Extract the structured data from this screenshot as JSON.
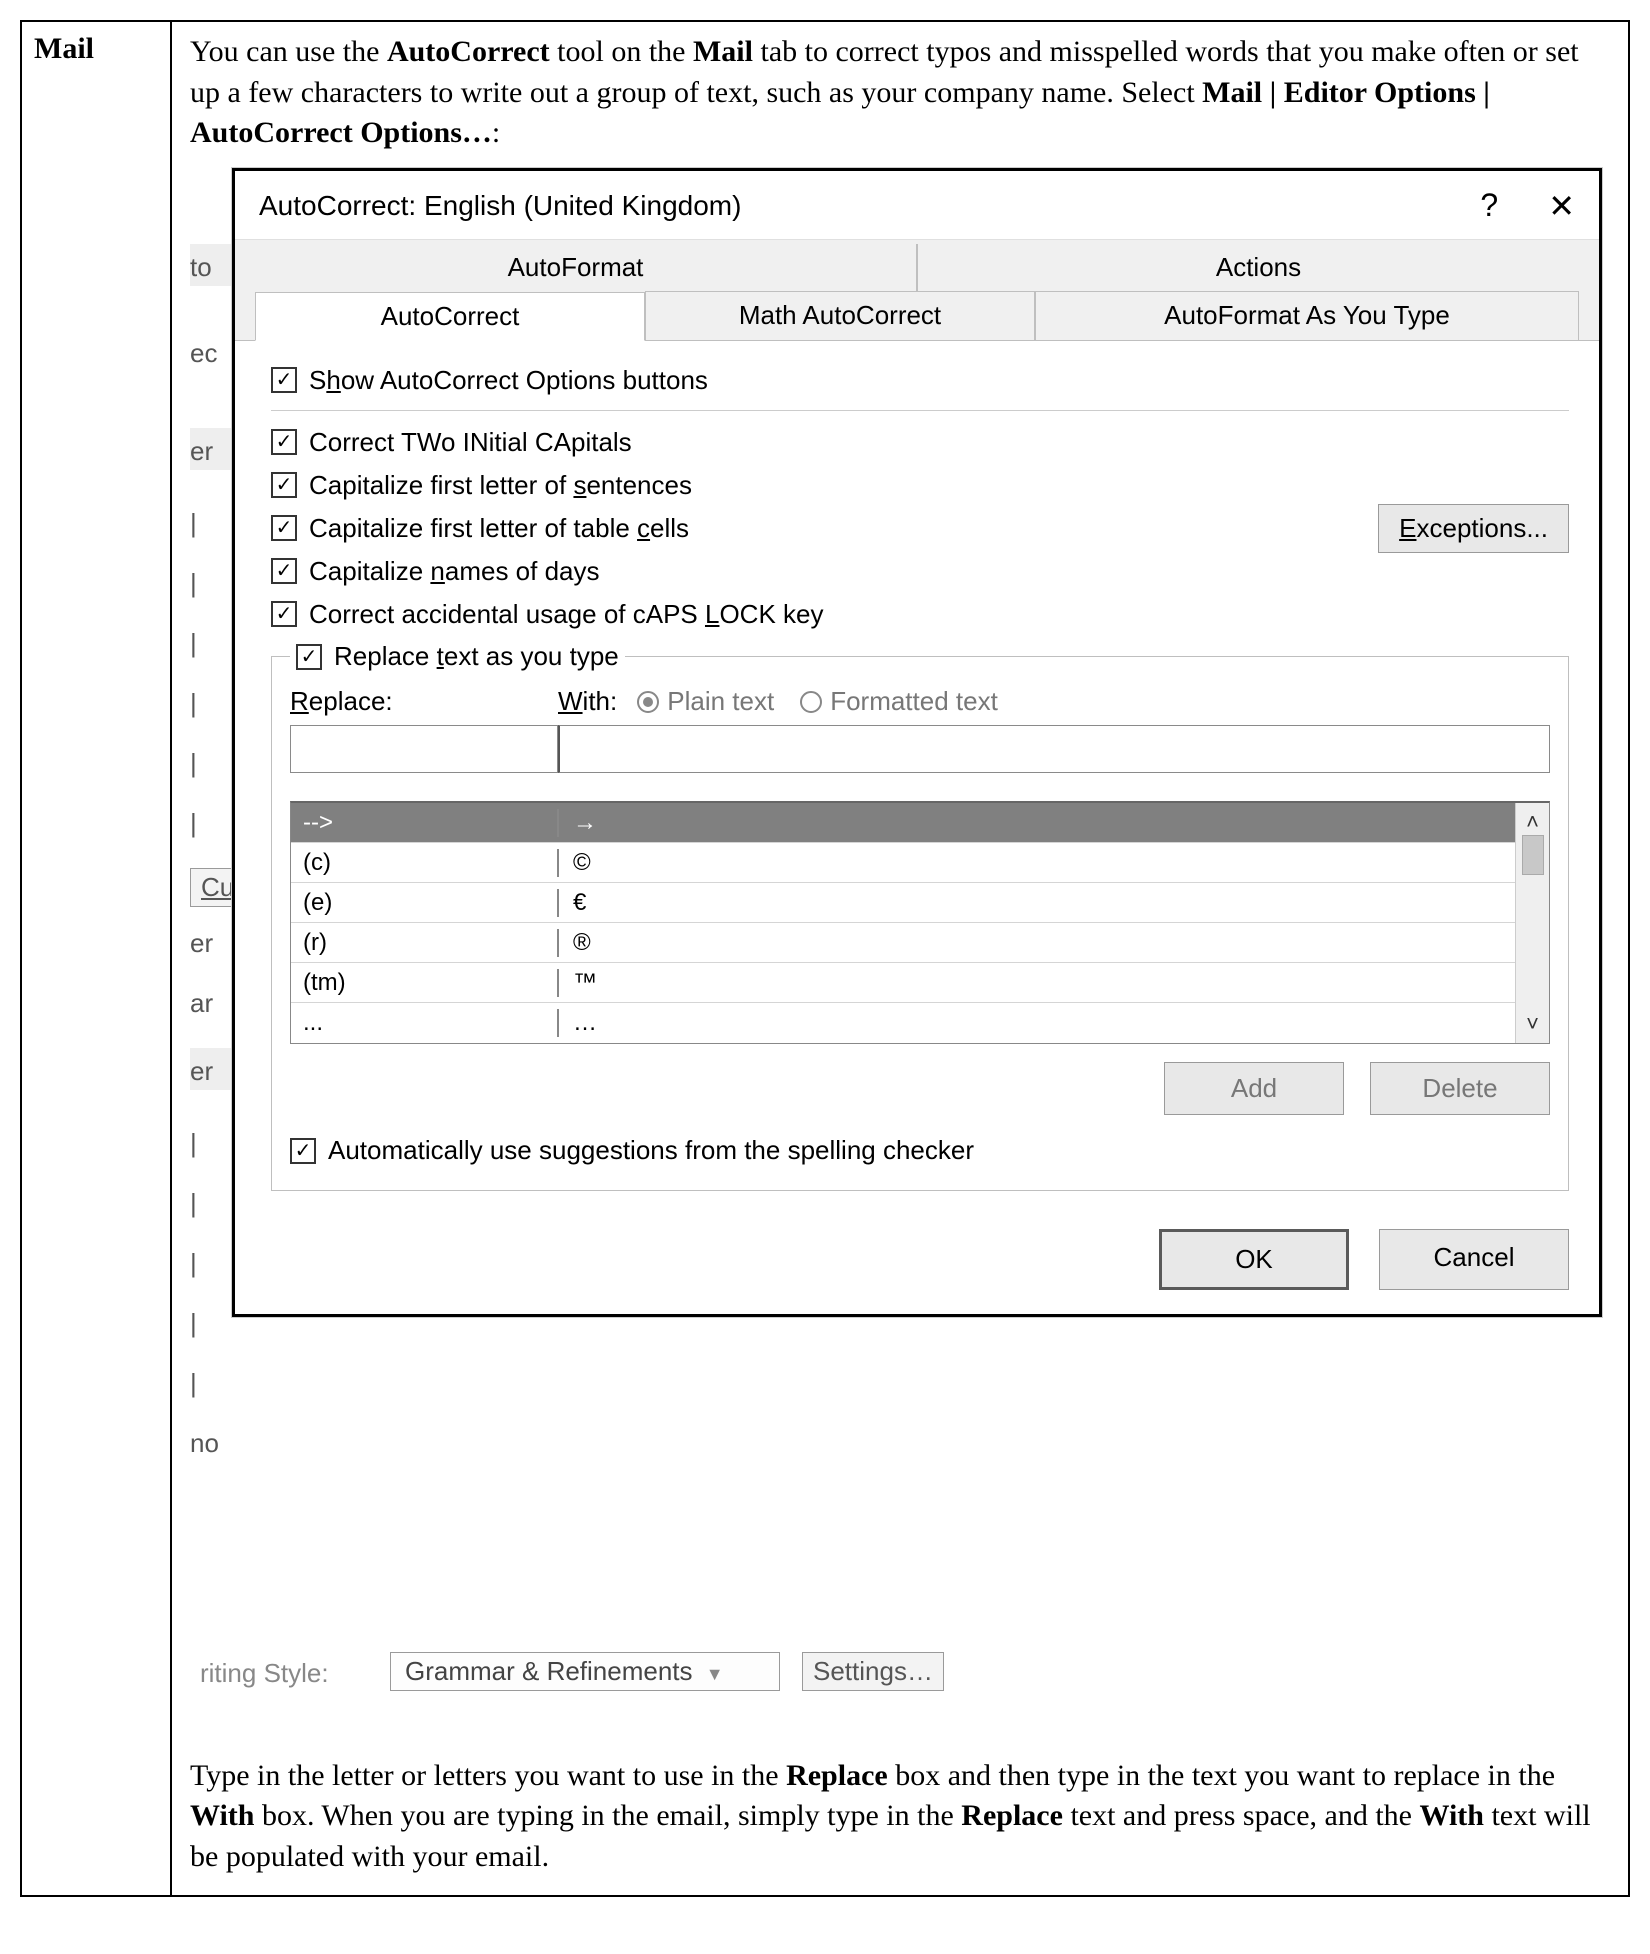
{
  "leftLabel": "Mail",
  "intro": {
    "p1a": "You can use the ",
    "b1": "AutoCorrect",
    "p1b": " tool on the ",
    "b2": "Mail",
    "p1c": " tab to correct typos and misspelled words that you make often or set up a few characters to write out a group of text, such as your company name. Select ",
    "b3": "Mail | Editor Options | AutoCorrect Options…",
    "p1d": ":"
  },
  "outro": {
    "p1a": "Type in the letter or letters you want to use in the ",
    "b1": "Replace",
    "p1b": " box and then type in the text you want to replace in the ",
    "b2": "With",
    "p1c": " box. When you are typing in the email, simply type in the ",
    "b3": "Replace",
    "p1d": " text and press space, and the ",
    "b4": "With",
    "p1e": " text will be populated with your email."
  },
  "bg": {
    "frag_to": "to",
    "frag_ec": "ec",
    "frag_er1": "er",
    "frag_er2": "er",
    "frag_er3": "er",
    "frag_ar": "ar",
    "frag_no": "no",
    "frag_cu": "Cu",
    "writing_style_label": "riting Style:",
    "writing_style_value": "Grammar & Refinements",
    "settings_btn": "Settings…"
  },
  "dialog": {
    "title": "AutoCorrect: English (United Kingdom)",
    "help": "?",
    "close": "✕",
    "tabs_row1": [
      "AutoFormat",
      "Actions"
    ],
    "tabs_row2": [
      "AutoCorrect",
      "Math AutoCorrect",
      "AutoFormat As You Type"
    ],
    "chk_show": "Show AutoCorrect Options buttons",
    "chk_show_u": "h",
    "chk_twocaps": "Correct TWo INitial CApitals",
    "chk_sentences": "Capitalize first letter of sentences",
    "chk_sentences_u": "s",
    "chk_tablecells": "Capitalize first letter of table cells",
    "chk_tablecells_u": "c",
    "chk_days": "Capitalize names of days",
    "chk_days_u": "n",
    "chk_capslock": "Correct accidental usage of cAPS LOCK key",
    "chk_capslock_u": "L",
    "exceptions": "Exceptions...",
    "exceptions_u": "E",
    "chk_replace_as_you_type": "Replace text as you type",
    "chk_replace_u": "t",
    "lbl_replace": "Replace:",
    "lbl_replace_u": "R",
    "lbl_with": "With:",
    "lbl_with_u": "W",
    "radio_plain": "Plain text",
    "radio_formatted": "Formatted text",
    "list": [
      {
        "r": "-->",
        "w": "→"
      },
      {
        "r": "(c)",
        "w": "©"
      },
      {
        "r": "(e)",
        "w": "€"
      },
      {
        "r": "(r)",
        "w": "®"
      },
      {
        "r": "(tm)",
        "w": "™"
      },
      {
        "r": "...",
        "w": "…"
      }
    ],
    "btn_add": "Add",
    "btn_delete": "Delete",
    "chk_suggestions": "Automatically use suggestions from the spelling checker",
    "chk_suggestions_u": "gg",
    "btn_ok": "OK",
    "btn_cancel": "Cancel"
  }
}
